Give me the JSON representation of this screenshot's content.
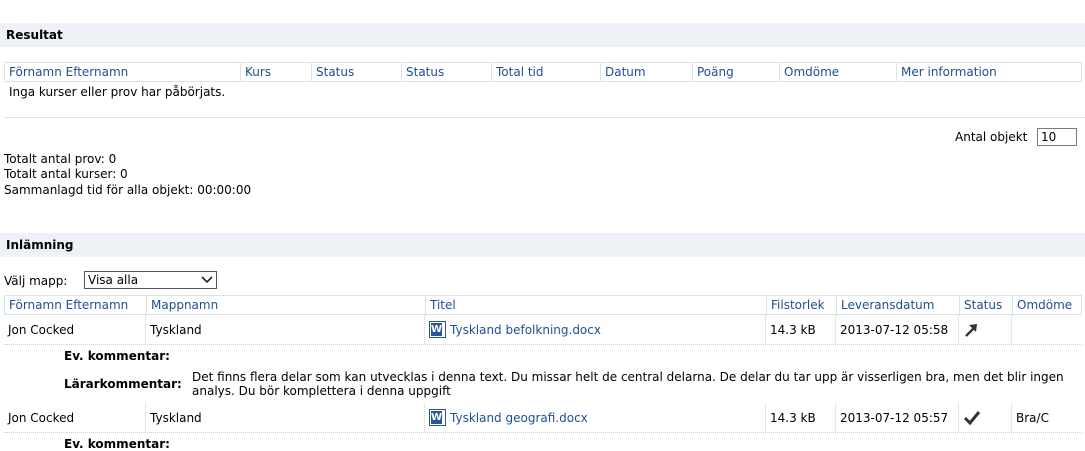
{
  "resultat": {
    "title": "Resultat",
    "columns": [
      "Förnamn  Efternamn",
      "Kurs",
      "Status",
      "Status",
      "Total tid",
      "Datum",
      "Poäng",
      "Omdöme",
      "Mer information"
    ],
    "empty_message": "Inga kurser eller prov har påbörjats.",
    "antal_objekt_label": "Antal objekt",
    "antal_objekt_value": "10",
    "summary": [
      "Totalt antal prov: 0",
      "Totalt antal kurser: 0",
      "Sammanlagd tid för alla objekt: 00:00:00"
    ]
  },
  "inlamning": {
    "title": "Inlämning",
    "folder_label": "Välj mapp:",
    "folder_selected": "Visa alla",
    "columns": [
      "Förnamn  Efternamn",
      "Mappnamn",
      "Titel",
      "Filstorlek",
      "Leveransdatum",
      "Status",
      "Omdöme"
    ],
    "rows": [
      {
        "name": "Jon Cocked",
        "folder": "Tyskland",
        "title": "Tyskland befolkning.docx",
        "size": "14.3 kB",
        "date": "2013-07-12 05:58",
        "status_icon": "arrow-icon",
        "grade": ""
      },
      {
        "name": "Jon Cocked",
        "folder": "Tyskland",
        "title": "Tyskland geografi.docx",
        "size": "14.3 kB",
        "date": "2013-07-12 05:57",
        "status_icon": "checkmark-icon",
        "grade": "Bra/C"
      }
    ],
    "ev_kommentar_label": "Ev. kommentar:",
    "lararkommentar_label": "Lärarkommentar:",
    "lararkommentar_line1": "Det finns flera delar som kan utvecklas i denna text. Du missar helt de central delarna. De delar du tar upp är visserligen bra, men det blir ingen",
    "lararkommentar_line2": "analys. Du bör komplettera i denna uppgift"
  }
}
